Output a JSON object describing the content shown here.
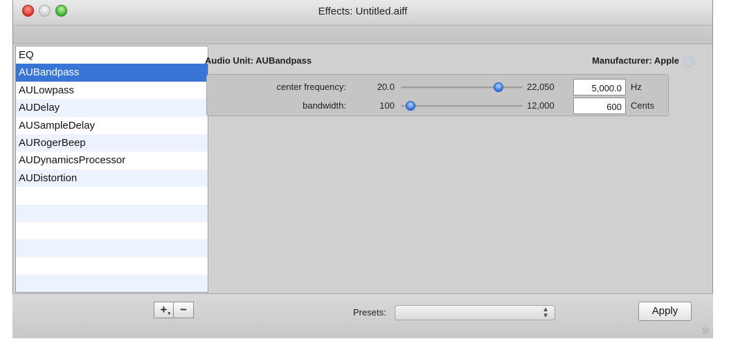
{
  "window": {
    "title": "Effects: Untitled.aiff"
  },
  "effects_list": {
    "items": [
      {
        "label": "EQ",
        "selected": false
      },
      {
        "label": "AUBandpass",
        "selected": true
      },
      {
        "label": "AULowpass",
        "selected": false
      },
      {
        "label": "AUDelay",
        "selected": false
      },
      {
        "label": "AUSampleDelay",
        "selected": false
      },
      {
        "label": "AURogerBeep",
        "selected": false
      },
      {
        "label": "AUDynamicsProcessor",
        "selected": false
      },
      {
        "label": "AUDistortion",
        "selected": false
      }
    ],
    "selection_color": "#3875d7"
  },
  "audio_unit": {
    "name_label": "Audio Unit: AUBandpass",
    "manufacturer_label": "Manufacturer: Apple"
  },
  "parameters": [
    {
      "name": "center frequency:",
      "min_label": "20.0",
      "max_label": "22,050",
      "value": "5,000.0",
      "unit": "Hz",
      "slider_fraction": 0.8
    },
    {
      "name": "bandwidth:",
      "min_label": "100",
      "max_label": "12,000",
      "value": "600",
      "unit": "Cents",
      "slider_fraction": 0.08
    }
  ],
  "bottom": {
    "add_label": "+",
    "remove_label": "−",
    "presets_label": "Presets:",
    "presets_value": "",
    "apply_label": "Apply"
  }
}
